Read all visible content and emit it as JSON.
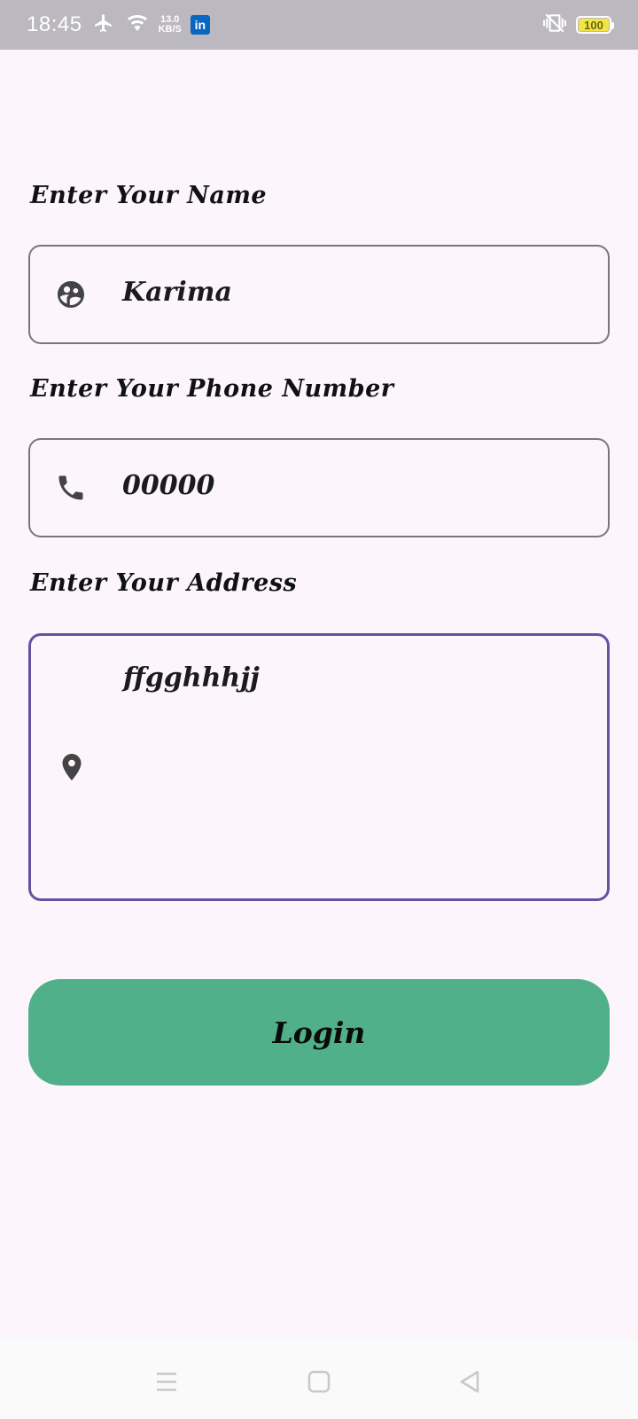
{
  "status_bar": {
    "time": "18:45",
    "speed_value": "13.0",
    "speed_unit": "KB/S",
    "app_badge": "in",
    "battery": "100"
  },
  "form": {
    "name_label": "Enter Your Name",
    "name_value": "Karima",
    "phone_label": "Enter Your Phone Number",
    "phone_value": "00000",
    "address_label": "Enter Your Address",
    "address_value": "ffgghhhjj"
  },
  "login_label": "Login",
  "colors": {
    "background": "#fcf6fc",
    "status_bar": "#bcb8bf",
    "focused_border": "#6750a4",
    "field_border": "#7b767e",
    "login_button": "#50b08a"
  },
  "icons": {
    "name": "face-icon",
    "phone": "phone-icon",
    "address": "location-pin-icon"
  }
}
